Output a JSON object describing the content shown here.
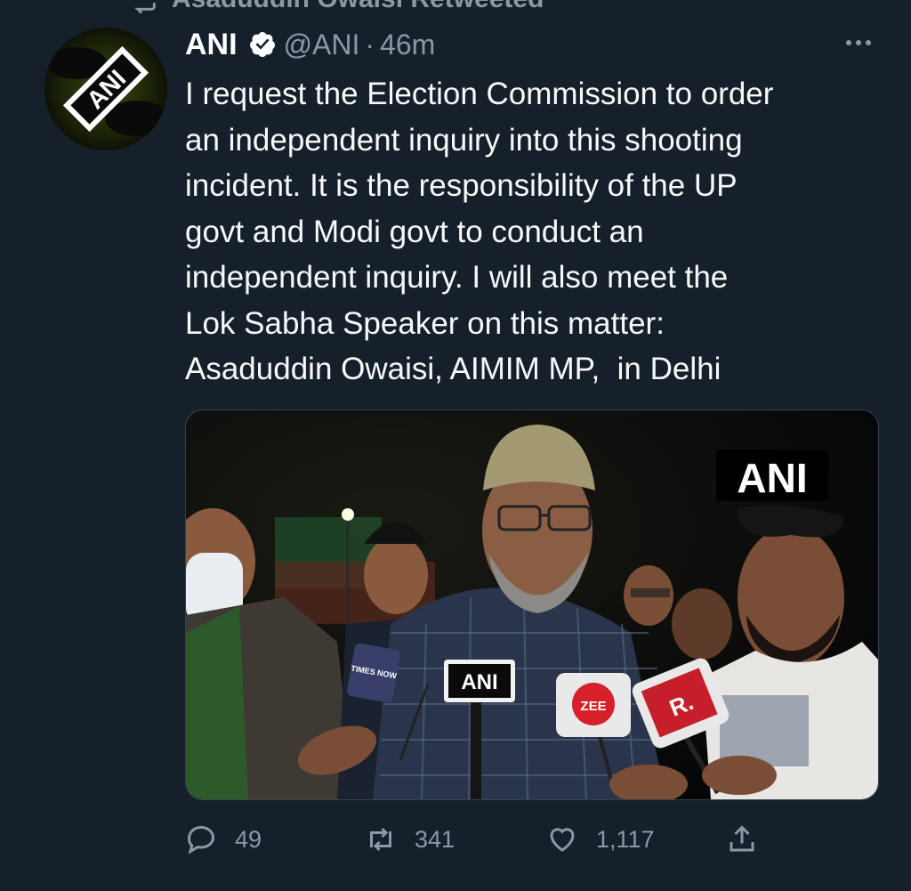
{
  "retweet_banner": {
    "text": "Asaduddin Owaisi Retweeted",
    "icon": "retweet-icon"
  },
  "tweet": {
    "author_name": "ANI",
    "handle": "@ANI",
    "separator": "·",
    "time": "46m",
    "verified": true,
    "avatar_text": "ANI",
    "text": "I request the Election Commission to order\nan independent inquiry into this shooting\nincident. It is the responsibility of the UP\ngovt and Modi govt to conduct an\nindependent inquiry. I will also meet the\nLok Sabha Speaker on this matter:\nAsaduddin Owaisi, AIMIM MP,  in Delhi",
    "media": {
      "watermark": "ANI",
      "mic_labels": {
        "times_now": "TIMES NOW",
        "ani": "ANI",
        "zee": "ZEE",
        "republic": "R."
      }
    }
  },
  "actions": {
    "reply": {
      "icon": "reply-icon",
      "count": "49"
    },
    "retweet": {
      "icon": "retweet-icon",
      "count": "341"
    },
    "like": {
      "icon": "heart-icon",
      "count": "1,117"
    },
    "share": {
      "icon": "share-icon"
    }
  },
  "colors": {
    "background": "#15202b",
    "text_primary": "#f7f9f9",
    "text_secondary": "#8b98a5",
    "verified": "#ffffff"
  }
}
